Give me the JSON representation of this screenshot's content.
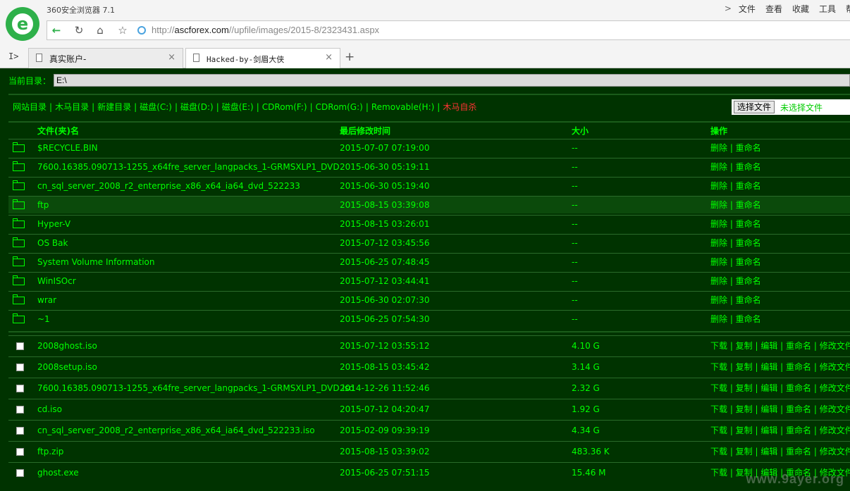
{
  "app": {
    "title": "360安全浏览器 7.1"
  },
  "menu": {
    "items": [
      "文件",
      "查看",
      "收藏",
      "工具",
      "帮"
    ]
  },
  "address": {
    "domain": "ascforex.com",
    "prefix": "http://",
    "path": "//upfile/images/2015-8/2323431.aspx"
  },
  "sidebar_toggle": "I>",
  "tabs": [
    {
      "label": "真实账户-",
      "active": false
    },
    {
      "label": "Hacked-by-剑眉大侠",
      "active": true
    }
  ],
  "new_tab": "+",
  "page": {
    "current_dir_label": "当前目录：",
    "current_dir_value": "E:\\",
    "links": [
      {
        "label": "网站目录",
        "color": "#00ff00"
      },
      {
        "label": "木马目录",
        "color": "#00ff00"
      },
      {
        "label": "新建目录",
        "color": "#00ff00"
      },
      {
        "label": "磁盘(C:)",
        "color": "#00ff00"
      },
      {
        "label": "磁盘(D:)",
        "color": "#00ff00"
      },
      {
        "label": "磁盘(E:)",
        "color": "#00ff00"
      },
      {
        "label": "CDRom(F:)",
        "color": "#00ff00"
      },
      {
        "label": "CDRom(G:)",
        "color": "#00ff00"
      },
      {
        "label": "Removable(H:)",
        "color": "#00ff00"
      },
      {
        "label": "木马自杀",
        "color": "#ff3333"
      }
    ],
    "upload": {
      "button": "选择文件",
      "status": "未选择文件"
    },
    "table": {
      "headers": {
        "name": "文件(夹)名",
        "time": "最后修改时间",
        "size": "大小",
        "ops": "操作"
      },
      "folders": [
        {
          "name": "$RECYCLE.BIN",
          "time": "2015-07-07 07:19:00",
          "size": "--",
          "ops": "删除 | 重命名"
        },
        {
          "name": "7600.16385.090713-1255_x64fre_server_langpacks_1-GRMSXLP1_DVD",
          "time": "2015-06-30 05:19:11",
          "size": "--",
          "ops": "删除 | 重命名"
        },
        {
          "name": "cn_sql_server_2008_r2_enterprise_x86_x64_ia64_dvd_522233",
          "time": "2015-06-30 05:19:40",
          "size": "--",
          "ops": "删除 | 重命名"
        },
        {
          "name": "ftp",
          "time": "2015-08-15 03:39:08",
          "size": "--",
          "ops": "删除 | 重命名",
          "highlight": true
        },
        {
          "name": "Hyper-V",
          "time": "2015-08-15 03:26:01",
          "size": "--",
          "ops": "删除 | 重命名"
        },
        {
          "name": "OS Bak",
          "time": "2015-07-12 03:45:56",
          "size": "--",
          "ops": "删除 | 重命名"
        },
        {
          "name": "System Volume Information",
          "time": "2015-06-25 07:48:45",
          "size": "--",
          "ops": "删除 | 重命名"
        },
        {
          "name": "WinISOcr",
          "time": "2015-07-12 03:44:41",
          "size": "--",
          "ops": "删除 | 重命名"
        },
        {
          "name": "wrar",
          "time": "2015-06-30 02:07:30",
          "size": "--",
          "ops": "删除 | 重命名"
        },
        {
          "name": "~1",
          "time": "2015-06-25 07:54:30",
          "size": "--",
          "ops": "删除 | 重命名"
        }
      ],
      "files": [
        {
          "name": "2008ghost.iso",
          "time": "2015-07-12 03:55:12",
          "size": "4.10 G",
          "ops": "下载 | 复制 | 编辑 | 重命名 | 修改文件"
        },
        {
          "name": "2008setup.iso",
          "time": "2015-08-15 03:45:42",
          "size": "3.14 G",
          "ops": "下载 | 复制 | 编辑 | 重命名 | 修改文件"
        },
        {
          "name": "7600.16385.090713-1255_x64fre_server_langpacks_1-GRMSXLP1_DVD.iso",
          "time": "2014-12-26 11:52:46",
          "size": "2.32 G",
          "ops": "下载 | 复制 | 编辑 | 重命名 | 修改文件"
        },
        {
          "name": "cd.iso",
          "time": "2015-07-12 04:20:47",
          "size": "1.92 G",
          "ops": "下载 | 复制 | 编辑 | 重命名 | 修改文件"
        },
        {
          "name": "cn_sql_server_2008_r2_enterprise_x86_x64_ia64_dvd_522233.iso",
          "time": "2015-02-09 09:39:19",
          "size": "4.34 G",
          "ops": "下载 | 复制 | 编辑 | 重命名 | 修改文件"
        },
        {
          "name": "ftp.zip",
          "time": "2015-08-15 03:39:02",
          "size": "483.36 K",
          "ops": "下载 | 复制 | 编辑 | 重命名 | 修改文件"
        },
        {
          "name": "ghost.exe",
          "time": "2015-06-25 07:51:15",
          "size": "15.46 M",
          "ops": "下载 | 复制 | 编辑 | 重命名 | 修改文件"
        }
      ]
    }
  },
  "watermark": "www.9ayer.org",
  "colors": {
    "page_bg": "#003300",
    "text_green": "#00ff00",
    "link_red": "#ff3333",
    "highlight_row": "#0b4a0b",
    "brand_green": "#2eb04a"
  }
}
